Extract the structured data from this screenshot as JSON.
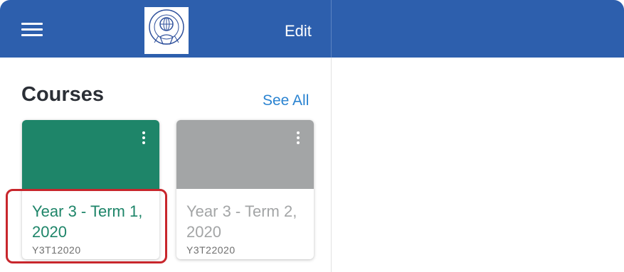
{
  "header": {
    "menu_icon": "hamburger-menu-icon",
    "logo_icon": "school-crest-logo",
    "edit_label": "Edit"
  },
  "colors": {
    "header_bg": "#2d5fad",
    "course1_accent": "#1e8569",
    "course2_accent": "#a3a5a6",
    "link": "#2a83d1",
    "highlight": "#c8262c"
  },
  "courses": {
    "title": "Courses",
    "see_all_label": "See All",
    "items": [
      {
        "name": "Year 3 - Term 1, 2020",
        "code": "Y3T12020",
        "kebab_icon": "more-vertical-icon"
      },
      {
        "name": "Year 3 - Term 2, 2020",
        "code": "Y3T22020",
        "kebab_icon": "more-vertical-icon"
      }
    ]
  }
}
